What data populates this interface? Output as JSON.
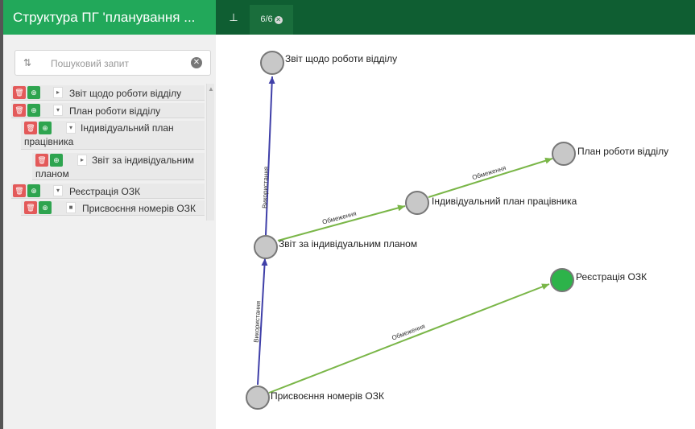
{
  "sidebar": {
    "title": "Структура ПГ 'планування ...",
    "search_placeholder": "Пошуковий запит",
    "items": [
      {
        "label": "Звіт щодо роботи відділу",
        "toggle": "▸"
      },
      {
        "label": "План роботи відділу",
        "toggle": "▾"
      },
      {
        "label_line1": "Індивідуальний план",
        "label_line2": "працівника",
        "toggle": "▾"
      },
      {
        "label_line1": "Звіт за індивідуальним",
        "label_line2": "планом",
        "toggle": "▸"
      },
      {
        "label": "Реєстрація ОЗК",
        "toggle": "▾"
      },
      {
        "label": "Присвоєння номерів ОЗК",
        "toggle": "■"
      }
    ]
  },
  "toolbar": {
    "tab_label": "6/6",
    "tab_close": "✕",
    "tree_icon": "⊥"
  },
  "graph": {
    "nodes": {
      "n1": {
        "label": "Звіт щодо роботи відділу",
        "color": "#c8c8c8"
      },
      "n2": {
        "label": "План роботи відділу",
        "color": "#c8c8c8"
      },
      "n3": {
        "label": "Індивідуальний план працівника",
        "color": "#c8c8c8"
      },
      "n4": {
        "label": "Звіт за індивідуальним планом",
        "color": "#c8c8c8"
      },
      "n5": {
        "label": "Реєстрація ОЗК",
        "color": "#2db34a"
      },
      "n6": {
        "label": "Присвоєння номерів ОЗК",
        "color": "#c8c8c8"
      }
    },
    "edges": {
      "use_upper": "Використання",
      "use_lower": "Використання",
      "limit_upper": "Обмеження",
      "limit_mid": "Обмеження",
      "limit_lower": "Обмеження"
    },
    "colors": {
      "use": "#3f3fa8",
      "limit": "#7ab648",
      "accent": "#22a85a",
      "topbar": "#0f5e32"
    }
  }
}
